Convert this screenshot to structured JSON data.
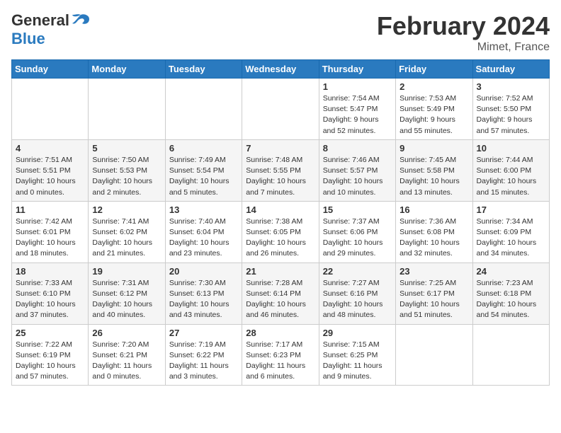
{
  "header": {
    "logo_general": "General",
    "logo_blue": "Blue",
    "month_title": "February 2024",
    "location": "Mimet, France"
  },
  "days_of_week": [
    "Sunday",
    "Monday",
    "Tuesday",
    "Wednesday",
    "Thursday",
    "Friday",
    "Saturday"
  ],
  "weeks": [
    [
      {
        "day": "",
        "info": ""
      },
      {
        "day": "",
        "info": ""
      },
      {
        "day": "",
        "info": ""
      },
      {
        "day": "",
        "info": ""
      },
      {
        "day": "1",
        "info": "Sunrise: 7:54 AM\nSunset: 5:47 PM\nDaylight: 9 hours\nand 52 minutes."
      },
      {
        "day": "2",
        "info": "Sunrise: 7:53 AM\nSunset: 5:49 PM\nDaylight: 9 hours\nand 55 minutes."
      },
      {
        "day": "3",
        "info": "Sunrise: 7:52 AM\nSunset: 5:50 PM\nDaylight: 9 hours\nand 57 minutes."
      }
    ],
    [
      {
        "day": "4",
        "info": "Sunrise: 7:51 AM\nSunset: 5:51 PM\nDaylight: 10 hours\nand 0 minutes."
      },
      {
        "day": "5",
        "info": "Sunrise: 7:50 AM\nSunset: 5:53 PM\nDaylight: 10 hours\nand 2 minutes."
      },
      {
        "day": "6",
        "info": "Sunrise: 7:49 AM\nSunset: 5:54 PM\nDaylight: 10 hours\nand 5 minutes."
      },
      {
        "day": "7",
        "info": "Sunrise: 7:48 AM\nSunset: 5:55 PM\nDaylight: 10 hours\nand 7 minutes."
      },
      {
        "day": "8",
        "info": "Sunrise: 7:46 AM\nSunset: 5:57 PM\nDaylight: 10 hours\nand 10 minutes."
      },
      {
        "day": "9",
        "info": "Sunrise: 7:45 AM\nSunset: 5:58 PM\nDaylight: 10 hours\nand 13 minutes."
      },
      {
        "day": "10",
        "info": "Sunrise: 7:44 AM\nSunset: 6:00 PM\nDaylight: 10 hours\nand 15 minutes."
      }
    ],
    [
      {
        "day": "11",
        "info": "Sunrise: 7:42 AM\nSunset: 6:01 PM\nDaylight: 10 hours\nand 18 minutes."
      },
      {
        "day": "12",
        "info": "Sunrise: 7:41 AM\nSunset: 6:02 PM\nDaylight: 10 hours\nand 21 minutes."
      },
      {
        "day": "13",
        "info": "Sunrise: 7:40 AM\nSunset: 6:04 PM\nDaylight: 10 hours\nand 23 minutes."
      },
      {
        "day": "14",
        "info": "Sunrise: 7:38 AM\nSunset: 6:05 PM\nDaylight: 10 hours\nand 26 minutes."
      },
      {
        "day": "15",
        "info": "Sunrise: 7:37 AM\nSunset: 6:06 PM\nDaylight: 10 hours\nand 29 minutes."
      },
      {
        "day": "16",
        "info": "Sunrise: 7:36 AM\nSunset: 6:08 PM\nDaylight: 10 hours\nand 32 minutes."
      },
      {
        "day": "17",
        "info": "Sunrise: 7:34 AM\nSunset: 6:09 PM\nDaylight: 10 hours\nand 34 minutes."
      }
    ],
    [
      {
        "day": "18",
        "info": "Sunrise: 7:33 AM\nSunset: 6:10 PM\nDaylight: 10 hours\nand 37 minutes."
      },
      {
        "day": "19",
        "info": "Sunrise: 7:31 AM\nSunset: 6:12 PM\nDaylight: 10 hours\nand 40 minutes."
      },
      {
        "day": "20",
        "info": "Sunrise: 7:30 AM\nSunset: 6:13 PM\nDaylight: 10 hours\nand 43 minutes."
      },
      {
        "day": "21",
        "info": "Sunrise: 7:28 AM\nSunset: 6:14 PM\nDaylight: 10 hours\nand 46 minutes."
      },
      {
        "day": "22",
        "info": "Sunrise: 7:27 AM\nSunset: 6:16 PM\nDaylight: 10 hours\nand 48 minutes."
      },
      {
        "day": "23",
        "info": "Sunrise: 7:25 AM\nSunset: 6:17 PM\nDaylight: 10 hours\nand 51 minutes."
      },
      {
        "day": "24",
        "info": "Sunrise: 7:23 AM\nSunset: 6:18 PM\nDaylight: 10 hours\nand 54 minutes."
      }
    ],
    [
      {
        "day": "25",
        "info": "Sunrise: 7:22 AM\nSunset: 6:19 PM\nDaylight: 10 hours\nand 57 minutes."
      },
      {
        "day": "26",
        "info": "Sunrise: 7:20 AM\nSunset: 6:21 PM\nDaylight: 11 hours\nand 0 minutes."
      },
      {
        "day": "27",
        "info": "Sunrise: 7:19 AM\nSunset: 6:22 PM\nDaylight: 11 hours\nand 3 minutes."
      },
      {
        "day": "28",
        "info": "Sunrise: 7:17 AM\nSunset: 6:23 PM\nDaylight: 11 hours\nand 6 minutes."
      },
      {
        "day": "29",
        "info": "Sunrise: 7:15 AM\nSunset: 6:25 PM\nDaylight: 11 hours\nand 9 minutes."
      },
      {
        "day": "",
        "info": ""
      },
      {
        "day": "",
        "info": ""
      }
    ]
  ]
}
